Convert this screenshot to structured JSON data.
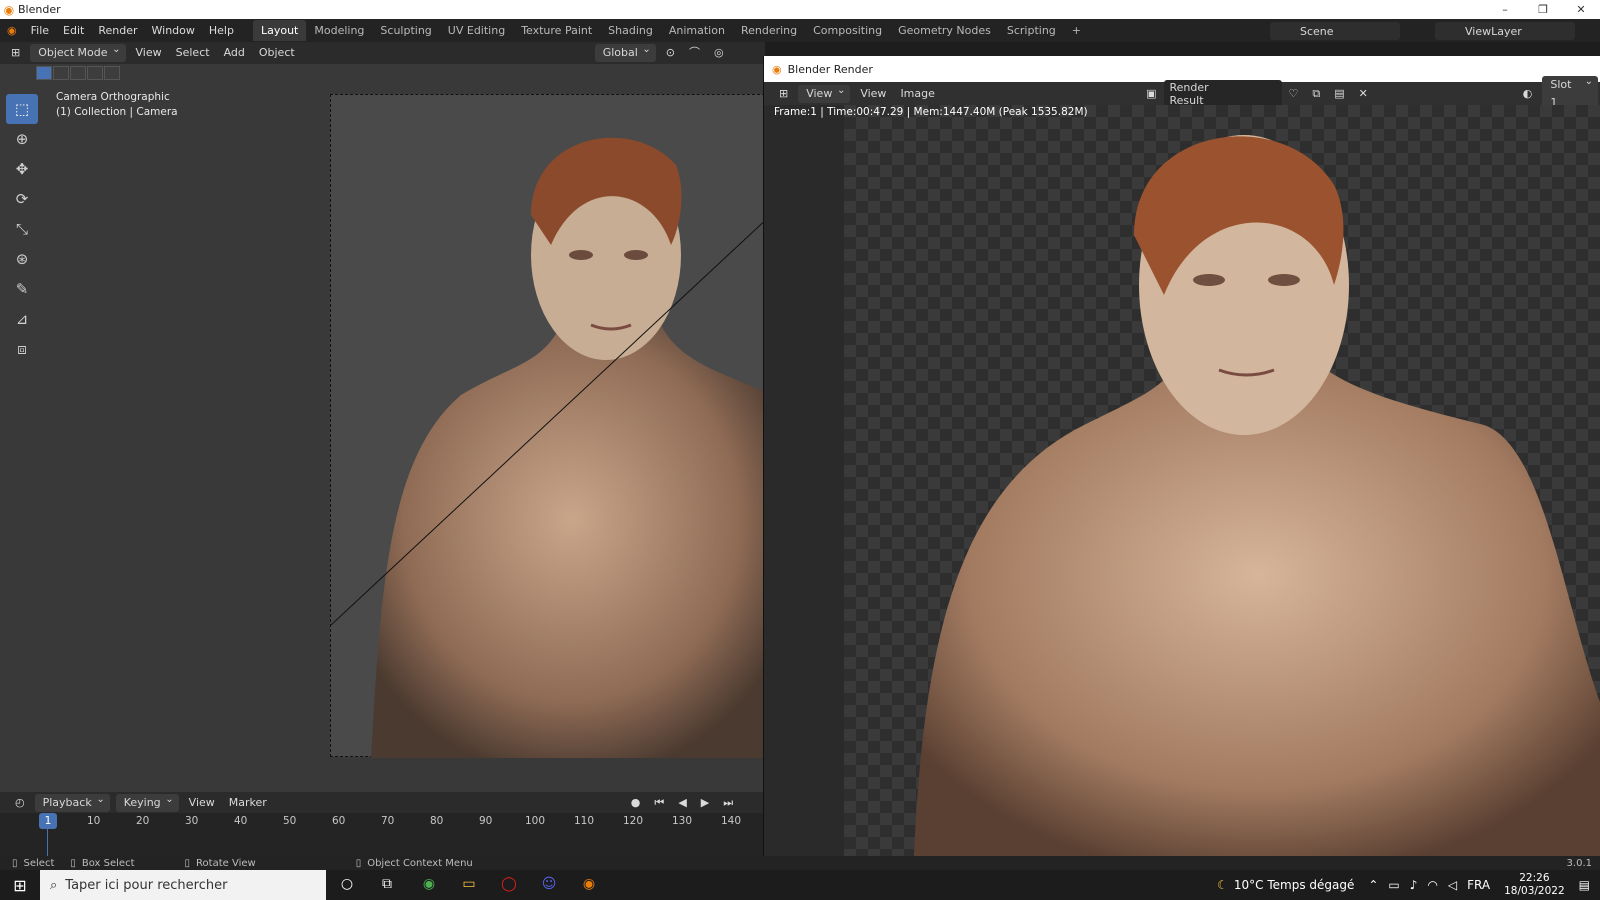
{
  "window": {
    "title": "Blender",
    "minimize": "–",
    "restore": "❐",
    "close": "✕"
  },
  "topbar": {
    "menus": [
      "File",
      "Edit",
      "Render",
      "Window",
      "Help"
    ],
    "workspaces": [
      "Layout",
      "Modeling",
      "Sculpting",
      "UV Editing",
      "Texture Paint",
      "Shading",
      "Animation",
      "Rendering",
      "Compositing",
      "Geometry Nodes",
      "Scripting"
    ],
    "active_workspace": "Layout",
    "add_tab": "+",
    "scene": "Scene",
    "view_layer": "ViewLayer"
  },
  "viewport_header": {
    "mode": "Object Mode",
    "menus": [
      "View",
      "Select",
      "Add",
      "Object"
    ],
    "transform_orientation": "Global"
  },
  "viewport": {
    "info_line1": "Camera Orthographic",
    "info_line2": "(1) Collection | Camera",
    "tools": [
      "select-box-icon",
      "cursor-icon",
      "move-icon",
      "rotate-icon",
      "scale-icon",
      "transform-icon",
      "annotate-icon",
      "measure-icon",
      "add-cube-icon"
    ]
  },
  "timeline": {
    "menus": [
      "Playback",
      "Keying",
      "View",
      "Marker"
    ],
    "current_frame": "1",
    "frame_ticks": [
      "10",
      "20",
      "30",
      "40",
      "50",
      "60",
      "70",
      "80",
      "90",
      "100",
      "110",
      "120",
      "130",
      "140"
    ]
  },
  "statusbar": {
    "select": "Select",
    "box_select": "Box Select",
    "rotate_view": "Rotate View",
    "context_menu": "Object Context Menu",
    "version": "3.0.1"
  },
  "render_window": {
    "title": "Blender Render",
    "menus": [
      "View",
      "View",
      "Image"
    ],
    "image_name": "Render Result",
    "slot": "Slot 1",
    "info": "Frame:1 | Time:00:47.29 | Mem:1447.40M (Peak 1535.82M)"
  },
  "taskbar": {
    "search_placeholder": "Taper ici pour rechercher",
    "weather": "10°C  Temps dégagé",
    "language": "FRA",
    "time": "22:26",
    "date": "18/03/2022"
  },
  "colors": {
    "accent": "#4772b3",
    "blender_orange": "#e87d0d"
  }
}
